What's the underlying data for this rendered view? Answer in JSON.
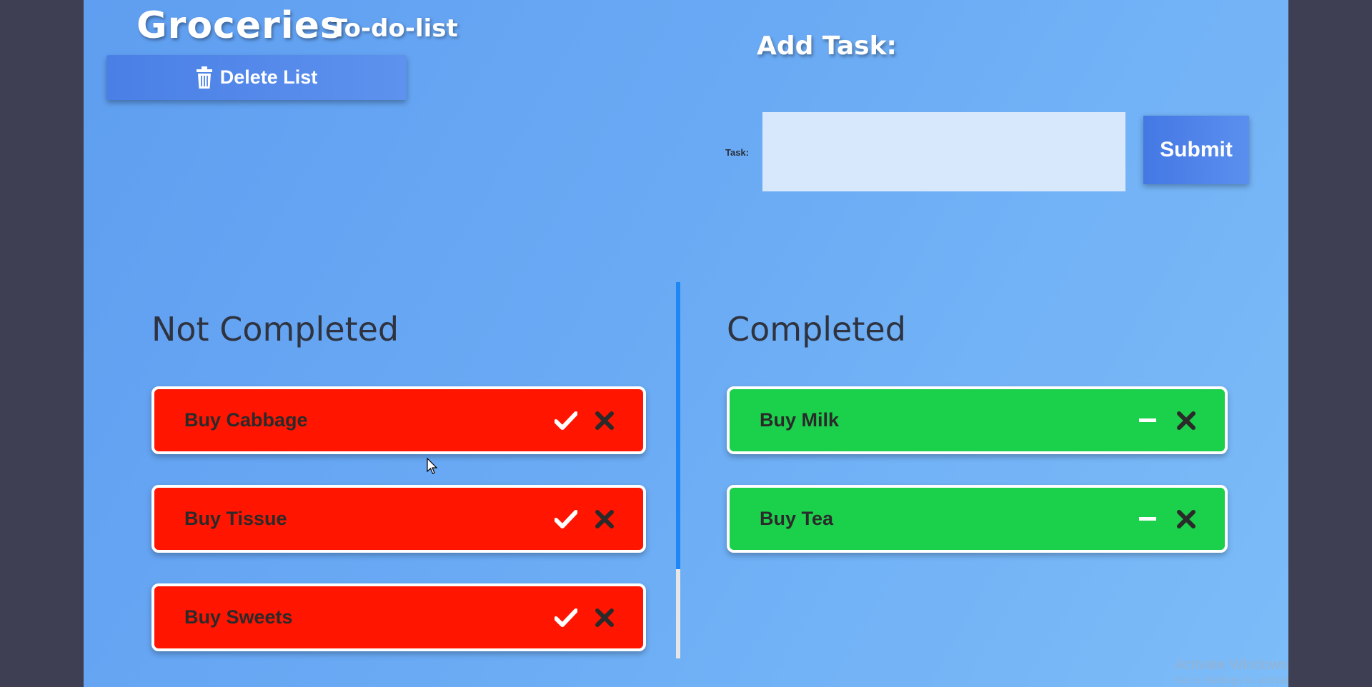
{
  "header": {
    "title": "Groceries",
    "subtitle": "To-do-list",
    "delete_label": "Delete List"
  },
  "add_task": {
    "title": "Add Task:",
    "field_label": "Task:",
    "input_value": "",
    "submit_label": "Submit"
  },
  "columns": {
    "not_completed_heading": "Not Completed",
    "completed_heading": "Completed"
  },
  "not_completed": [
    {
      "label": "Buy Cabbage"
    },
    {
      "label": "Buy Tissue"
    },
    {
      "label": "Buy Sweets"
    }
  ],
  "completed": [
    {
      "label": "Buy Milk"
    },
    {
      "label": "Buy Tea"
    }
  ],
  "watermark": {
    "line1": "Activate Windows",
    "line2": "Go to Settings to activate Windows."
  },
  "colors": {
    "not_completed_card": "#ff1500",
    "completed_card": "#1bd04a",
    "accent_blue": "#1f87f5"
  },
  "icons": {
    "delete": "trash-icon",
    "complete": "check-icon",
    "remove": "close-icon",
    "undo": "minus-icon"
  }
}
